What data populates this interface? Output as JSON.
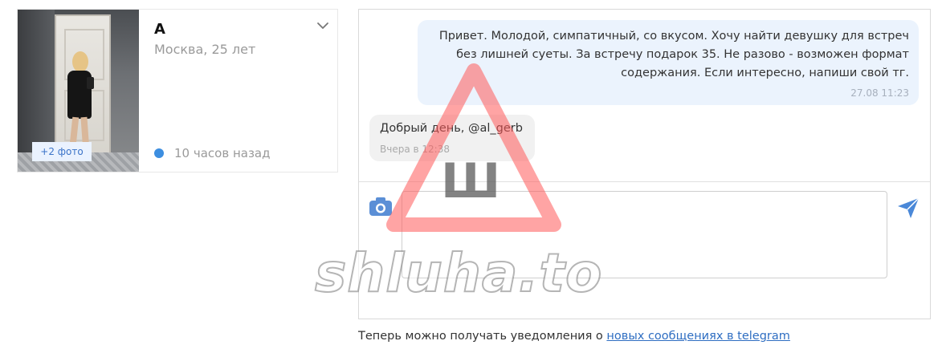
{
  "profile": {
    "name": "А",
    "meta": "Москва, 25 лет",
    "photo_badge": "+2 фото",
    "status": "10 часов назад",
    "status_color": "#3d8ee0"
  },
  "messages": [
    {
      "direction": "outgoing",
      "text": "Привет. Молодой, симпатичный, со вкусом. Хочу найти девушку для встреч без лишней суеты. За встречу подарок 35. Не разово - возможен формат содержания. Если интересно, напиши свой тг.",
      "time": "27.08 11:23"
    },
    {
      "direction": "incoming",
      "text": "Добрый день, @al_gerb",
      "time": "Вчера в 12:38"
    }
  ],
  "composer": {
    "placeholder": "",
    "value": ""
  },
  "footer": {
    "text": "Теперь можно получать уведомления о ",
    "link_text": "новых сообщениях в telegram"
  },
  "watermark": {
    "text": "shluha.to",
    "glyph": "Ш"
  },
  "colors": {
    "accent": "#3d8ee0",
    "outgoing_bubble": "#ebf3fd",
    "incoming_bubble": "#f1f1f1",
    "link": "#2f6ec2",
    "watermark_red": "#ff6b6b"
  }
}
